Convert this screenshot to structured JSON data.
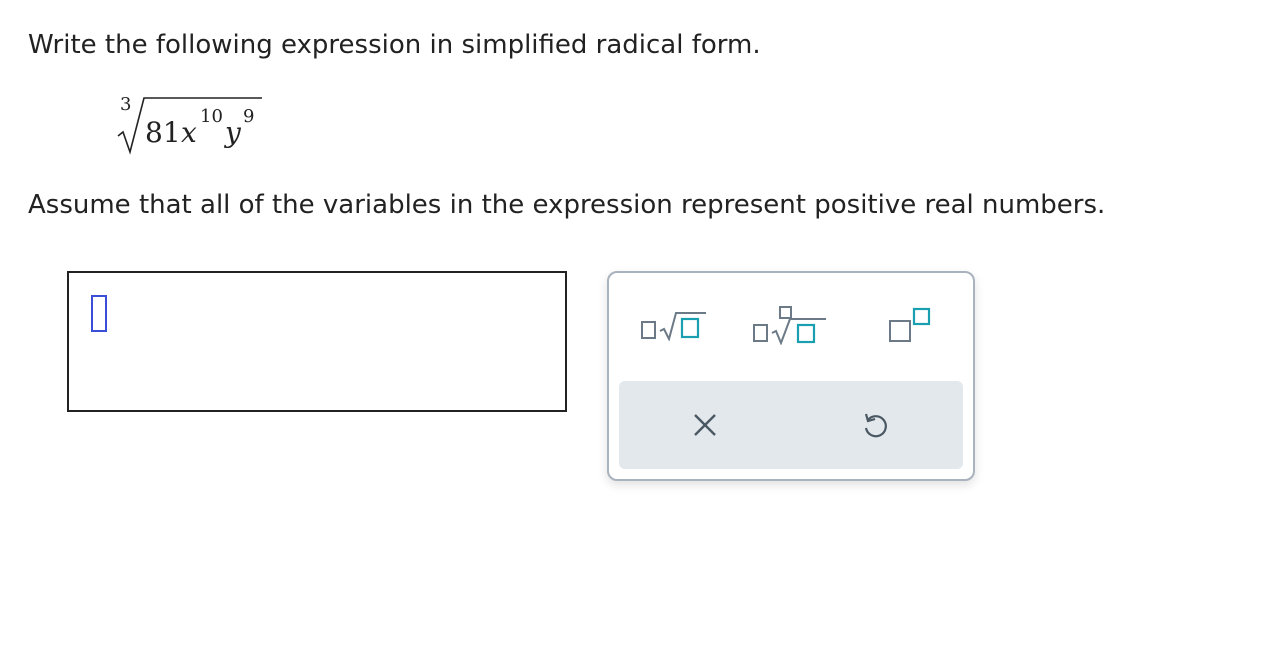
{
  "question": {
    "prompt": "Write the following expression in simplified radical form.",
    "assumption": "Assume that all of the variables in the expression represent positive real numbers."
  },
  "expression": {
    "index": "3",
    "coefficient": "81",
    "var1": "x",
    "exp1": "10",
    "var2": "y",
    "exp2": "9"
  },
  "answer": {
    "value": ""
  },
  "palette": {
    "tools": [
      {
        "name": "square-root-template",
        "icon": "sqrt-icon"
      },
      {
        "name": "nth-root-template",
        "icon": "nth-root-icon"
      },
      {
        "name": "exponent-template",
        "icon": "superscript-icon"
      }
    ],
    "actions": [
      {
        "name": "clear",
        "icon": "close-icon"
      },
      {
        "name": "undo",
        "icon": "undo-icon"
      }
    ],
    "colors": {
      "template_gray": "#6b7a86",
      "template_teal": "#1a9fb0",
      "action_bg": "#e2e8ec",
      "caret": "#3a4ed8"
    }
  }
}
